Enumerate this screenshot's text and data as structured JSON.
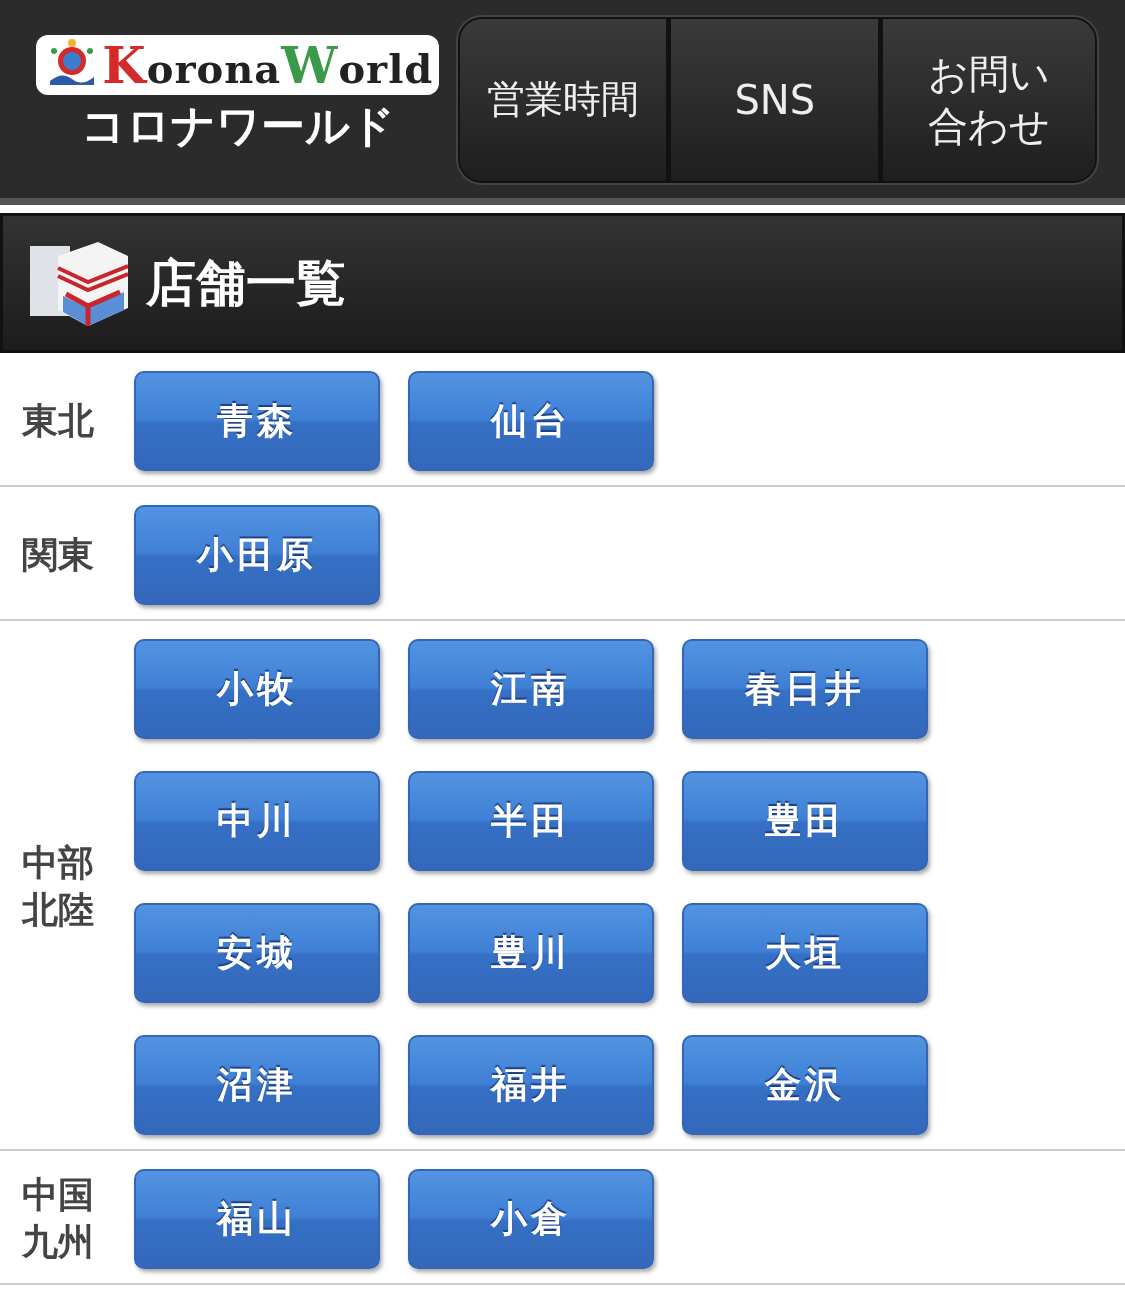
{
  "header": {
    "logo": {
      "latin": [
        {
          "text": "K",
          "color": "#d42a2a"
        },
        {
          "text": "orona",
          "color": "#222222"
        },
        {
          "text": "W",
          "color": "#3a9a4a"
        },
        {
          "text": "orld",
          "color": "#222222"
        }
      ],
      "kana": "コロナワールド"
    },
    "nav": [
      "営業時間",
      "SNS",
      "お問い合わせ"
    ]
  },
  "title": "店舗一覧",
  "regions": [
    {
      "name": "東北",
      "stores": [
        "青森",
        "仙台"
      ]
    },
    {
      "name": "関東",
      "stores": [
        "小田原"
      ]
    },
    {
      "name": "中部北陸",
      "stores": [
        "小牧",
        "江南",
        "春日井",
        "中川",
        "半田",
        "豊田",
        "安城",
        "豊川",
        "大垣",
        "沼津",
        "福井",
        "金沢"
      ]
    },
    {
      "name": "中国九州",
      "stores": [
        "福山",
        "小倉"
      ]
    }
  ]
}
